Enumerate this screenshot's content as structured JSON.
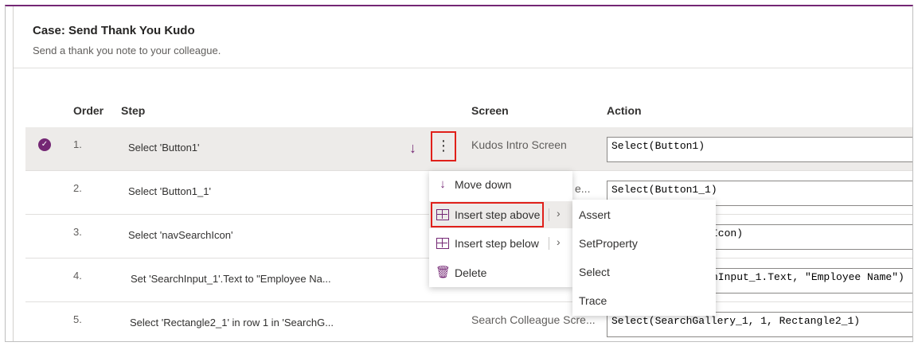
{
  "case": {
    "title": "Case: Send Thank You Kudo",
    "description": "Send a thank you note to your colleague."
  },
  "columns": {
    "order": "Order",
    "step": "Step",
    "screen": "Screen",
    "action": "Action"
  },
  "rows": [
    {
      "order": "1.",
      "step": "Select 'Button1'",
      "screen": "Kudos Intro Screen",
      "action": "Select(Button1)"
    },
    {
      "order": "2.",
      "step": "Select 'Button1_1'",
      "screen": "e...",
      "action": "Select(Button1_1)"
    },
    {
      "order": "3.",
      "step": "Select 'navSearchIcon'",
      "screen": "",
      "action": "Icon)"
    },
    {
      "order": "4.",
      "step": "Set 'SearchInput_1'.Text to \"Employee Na...",
      "screen": "",
      "action": "hInput_1.Text, \"Employee Name\")"
    },
    {
      "order": "5.",
      "step": "Select 'Rectangle2_1' in row 1 in 'SearchG...",
      "screen": "Search Colleague Scre...",
      "action": "Select(SearchGallery_1, 1, Rectangle2_1)"
    }
  ],
  "context_menu": {
    "move_down": "Move down",
    "insert_above": "Insert step above",
    "insert_below": "Insert step below",
    "delete": "Delete"
  },
  "submenu": [
    "Assert",
    "SetProperty",
    "Select",
    "Trace"
  ],
  "icons": {
    "selected": "check-circle-icon",
    "move_down": "arrow-down-icon",
    "more": "more-vertical-icon",
    "insert": "insert-grid-icon",
    "delete": "trash-icon",
    "chevron": "chevron-right-icon"
  },
  "colors": {
    "accent": "#742774",
    "highlight_box": "#e0201a",
    "selected_row": "#edebe9"
  }
}
